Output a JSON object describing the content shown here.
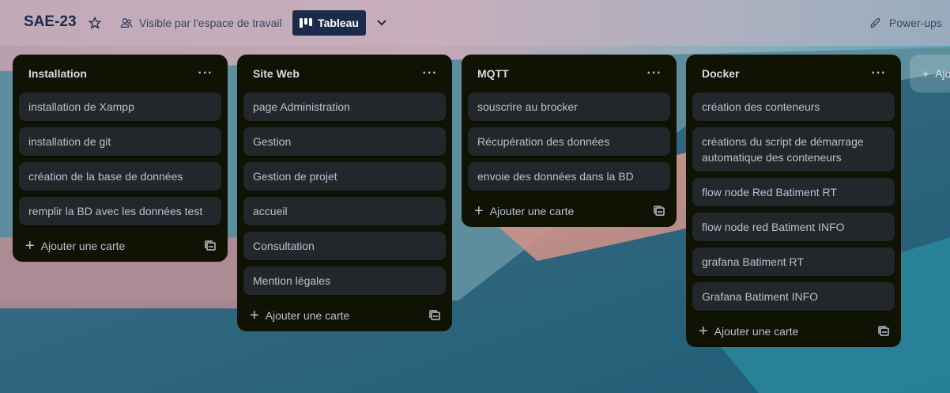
{
  "header": {
    "board_title": "SAE-23",
    "star_icon": "star-icon",
    "visibility_icon": "workspace-visibility-icon",
    "visibility_label": "Visible par l'espace de travail",
    "view_icon": "board-view-icon",
    "view_label": "Tableau",
    "view_chevron_icon": "chevron-down-icon",
    "powerups_icon": "rocket-icon",
    "powerups_label": "Power-ups"
  },
  "lists": [
    {
      "title": "Installation",
      "menu": "···",
      "cards": [
        "installation de Xampp",
        "installation de git",
        "création de la base de données",
        "remplir la BD avec les données test"
      ],
      "add_card_label": "Ajouter une carte"
    },
    {
      "title": "Site Web",
      "menu": "···",
      "cards": [
        "page Administration",
        "Gestion",
        "Gestion de projet",
        "accueil",
        "Consultation",
        "Mention légales"
      ],
      "add_card_label": "Ajouter une carte"
    },
    {
      "title": "MQTT",
      "menu": "···",
      "cards": [
        "souscrire au brocker",
        "Récupération des données",
        "envoie des données dans la BD"
      ],
      "add_card_label": "Ajouter une carte"
    },
    {
      "title": "Docker",
      "menu": "···",
      "cards": [
        "création des conteneurs",
        "créations du script de démarrage automatique des conteneurs",
        "flow node Red Batiment RT",
        "flow node red Batiment INFO",
        "grafana Batiment RT",
        "Grafana Batiment INFO"
      ],
      "add_card_label": "Ajouter une carte"
    }
  ],
  "add_list": {
    "plus": "+",
    "label": "Ajouter une autre liste"
  },
  "colors": {
    "list_bg": "#101204",
    "card_bg": "#22272b",
    "card_text": "#b6c2cf",
    "header_button": "#1c2b4a"
  }
}
